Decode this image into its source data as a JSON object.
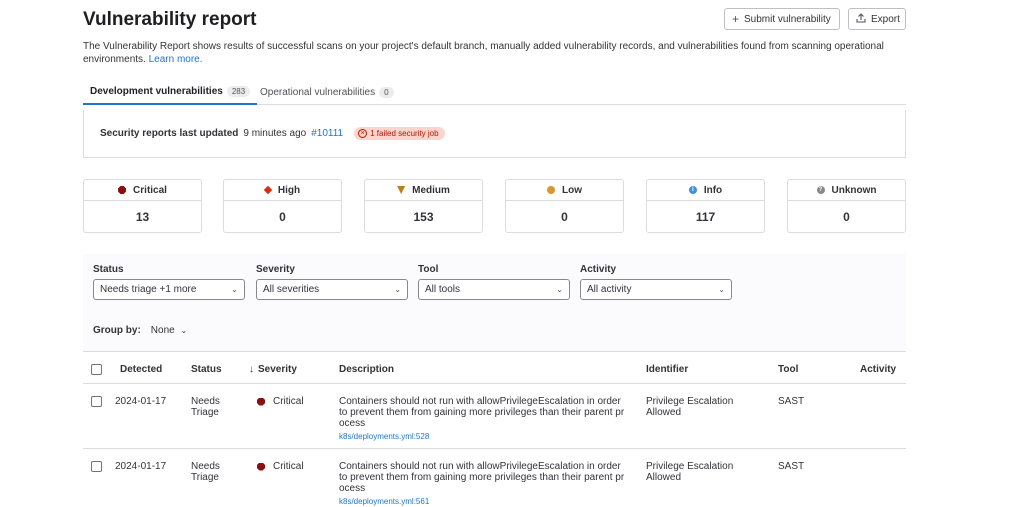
{
  "header": {
    "title": "Vulnerability report",
    "submit_label": "Submit vulnerability",
    "export_label": "Export",
    "description": "The Vulnerability Report shows results of successful scans on your project's default branch, manually added vulnerability records, and vulnerabilities found from scanning operational environments.",
    "learn_more": "Learn more."
  },
  "tabs": [
    {
      "label": "Development vulnerabilities",
      "count": "283"
    },
    {
      "label": "Operational vulnerabilities",
      "count": "0"
    }
  ],
  "last_updated": {
    "label": "Security reports last updated",
    "time": "9 minutes ago",
    "pipeline": "#10111",
    "failed": "1 failed security job"
  },
  "severity_counts": [
    {
      "label": "Critical",
      "value": "13"
    },
    {
      "label": "High",
      "value": "0"
    },
    {
      "label": "Medium",
      "value": "153"
    },
    {
      "label": "Low",
      "value": "0"
    },
    {
      "label": "Info",
      "value": "117"
    },
    {
      "label": "Unknown",
      "value": "0"
    }
  ],
  "filters": [
    {
      "label": "Status",
      "value": "Needs triage +1 more"
    },
    {
      "label": "Severity",
      "value": "All severities"
    },
    {
      "label": "Tool",
      "value": "All tools"
    },
    {
      "label": "Activity",
      "value": "All activity"
    }
  ],
  "group_by": {
    "label": "Group by:",
    "value": "None"
  },
  "table": {
    "columns": [
      "Detected",
      "Status",
      "Severity",
      "Description",
      "Identifier",
      "Tool",
      "Activity"
    ],
    "rows": [
      {
        "detected": "2024-01-17",
        "status": "Needs Triage",
        "severity": "Critical",
        "description": "Containers should not run with allowPrivilegeEscalation in order to prevent them from gaining more privileges than their parent process",
        "path": "k8s/deployments.yml:528",
        "identifier": "Privilege Escalation Allowed",
        "tool": "SAST"
      },
      {
        "detected": "2024-01-17",
        "status": "Needs Triage",
        "severity": "Critical",
        "description": "Containers should not run with allowPrivilegeEscalation in order to prevent them from gaining more privileges than their parent process",
        "path": "k8s/deployments.yml:561",
        "identifier": "Privilege Escalation Allowed",
        "tool": "SAST"
      }
    ]
  },
  "colors": {
    "accent": "#1f75cb",
    "critical": "#8b0f0f",
    "high": "#dd2b0e",
    "medium": "#c17d10",
    "low": "#d99530",
    "info": "#428fdc",
    "unknown": "#89888d"
  }
}
